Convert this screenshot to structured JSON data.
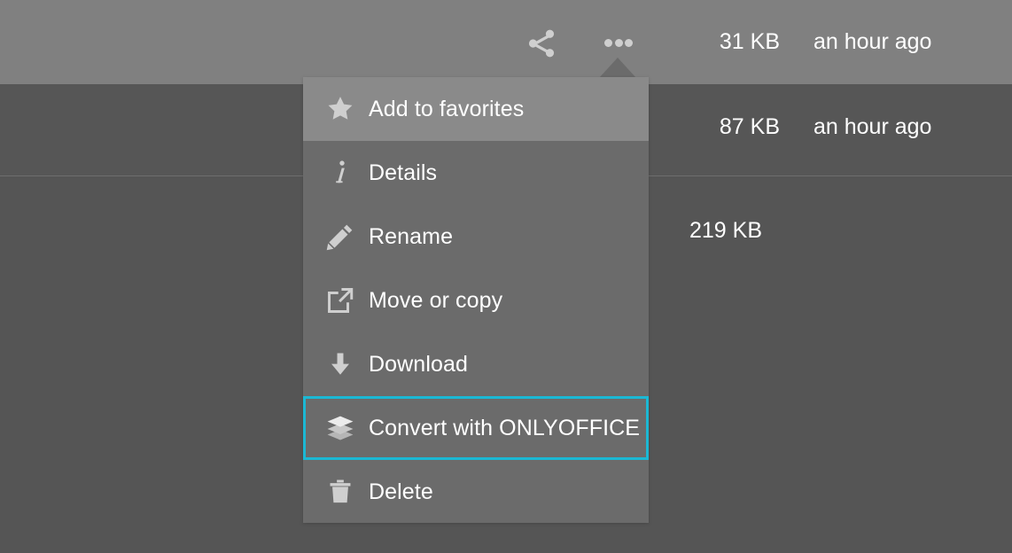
{
  "theme": {
    "row_light_bg": "#808080",
    "row_mid_bg": "#565656",
    "row_dark_bg": "#555555",
    "menu_bg": "#6b6b6b",
    "menu_active_bg": "#8a8a8a",
    "focus_outline": "#1bb8d4",
    "icon_color": "#cfcfcf",
    "text_color": "#ffffff"
  },
  "filelist": {
    "rows": [
      {
        "size": "31 KB",
        "modified": "an hour ago",
        "selected": true,
        "actions": [
          {
            "name": "share-icon",
            "label": "Share"
          },
          {
            "name": "more-actions-icon",
            "label": "Actions"
          }
        ]
      },
      {
        "size": "87 KB",
        "modified": "an hour ago",
        "selected": false,
        "actions": []
      },
      {
        "size": "219 KB",
        "modified": "",
        "selected": false,
        "actions": []
      }
    ]
  },
  "popup_menu": {
    "open": true,
    "anchor": "more-actions-icon",
    "items": [
      {
        "icon": "star-icon",
        "label": "Add to favorites",
        "state": "hover"
      },
      {
        "icon": "info-icon",
        "label": "Details",
        "state": "normal"
      },
      {
        "icon": "pencil-icon",
        "label": "Rename",
        "state": "normal"
      },
      {
        "icon": "external-link-icon",
        "label": "Move or copy",
        "state": "normal"
      },
      {
        "icon": "download-icon",
        "label": "Download",
        "state": "normal"
      },
      {
        "icon": "layers-icon",
        "label": "Convert with ONLYOFFICE",
        "state": "focused"
      },
      {
        "icon": "trash-icon",
        "label": "Delete",
        "state": "normal"
      }
    ]
  }
}
